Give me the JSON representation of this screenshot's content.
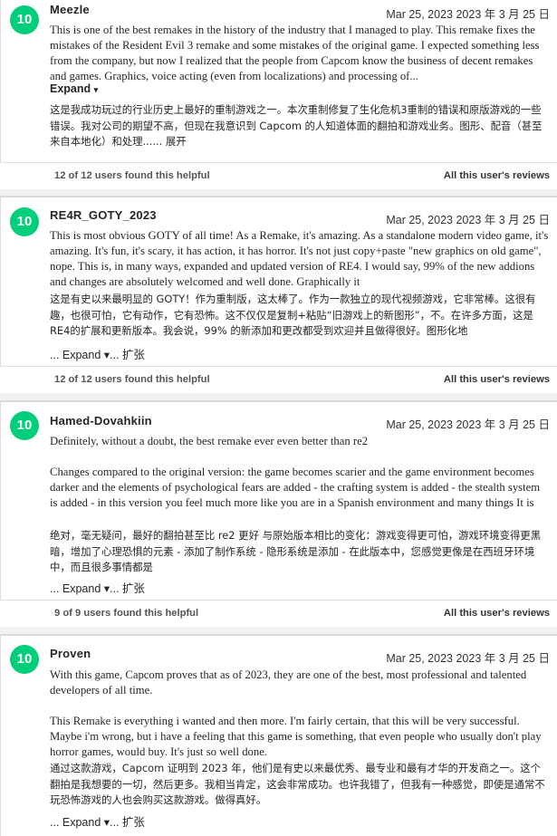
{
  "reviews": [
    {
      "score": "10",
      "user": "Meezle",
      "date": "Mar 25, 2023 2023 年 3 月 25 日",
      "text": "This is one of the best remakes in the history of the industry that I managed to play. This remake fixes the mistakes of the Resident Evil 3 remake and some mistakes of the original game. I expected something less from the company, but now I realized that the people from Capcom know the business of decent remakes and games. Graphics, voice acting (even from localizations) and processing of...",
      "expand": "Expand",
      "translation": "这是我成功玩过的行业历史上最好的重制游戏之一。本次重制修复了生化危机3重制的错误和原版游戏的一些错误。我对公司的期望不高，但现在我意识到 Capcom 的人知道体面的翻拍和游戏业务。图形、配音（甚至来自本地化）和处理...... 展开",
      "helpful": "12 of 12 users found this helpful",
      "all_reviews": "All this user's reviews"
    },
    {
      "score": "10",
      "user": "RE4R_GOTY_2023",
      "date": "Mar 25, 2023 2023 年 3 月 25 日",
      "text": "This is most obvious GOTY of all time! As a Remake, it's amazing. As a standalone modern video game, it's amazing. It's fun, it's scary, it has action, it has horror. It's not just copy+paste \"new graphics on old game\", nope. This is, in many ways, expanded and updated version of RE4. I would say, 99% of the new addions and changes are absolutely welcomed and well done. Graphically it",
      "translation": "这是有史以来最明显的 GOTY！作为重制版，这太棒了。作为一款独立的现代视频游戏，它非常棒。这很有趣，也很可怕，它有动作，它有恐怖。这不仅仅是复制+粘贴“旧游戏上的新图形”，不。在许多方面，这是 RE4的扩展和更新版本。我会说，99% 的新添加和更改都受到欢迎并且做得很好。图形化地",
      "expand": "... Expand ▾... 扩张",
      "helpful": "12 of 12 users found this helpful",
      "all_reviews": "All this user's reviews"
    },
    {
      "score": "10",
      "user": "Hamed-Dovahkiin",
      "date": "Mar 25, 2023 2023 年 3 月 25 日",
      "text": "Definitely, without a doubt, the best remake ever even better than re2\n\nChanges compared to the original version: the game becomes scarier and the game environment becomes darker and the elements of psychological fears are added - the crafting system is added - the stealth system is added - in this version you feel much more like you are in a Spanish environment and many things It is",
      "translation": "绝对，毫无疑问，最好的翻拍甚至比 re2 更好 与原始版本相比的变化：游戏变得更可怕，游戏环境变得更黑暗，增加了心理恐惧的元素 - 添加了制作系统 - 隐形系统是添加 - 在此版本中，您感觉更像是在西班牙环境中，而且很多事情都是",
      "expand": "... Expand ▾... 扩张",
      "helpful": "9 of 9 users found this helpful",
      "all_reviews": "All this user's reviews"
    },
    {
      "score": "10",
      "user": "Proven",
      "date": "Mar 25, 2023 2023 年 3 月 25 日",
      "text": "With this game, Capcom proves that as of 2023, they are one of the best, most professional and talented developers of all time.\n\nThis Remake is everything i wanted and then more. I'm fairly certain, that this will be very successful. Maybe i'm wrong, but i have a feeling that this game is something, that even people who usually don't play horror games, would buy. It's just so well done.",
      "translation": "通过这款游戏，Capcom 证明到 2023 年，他们是有史以来最优秀、最专业和最有才华的开发商之一。这个翻拍是我想要的一切，然后更多。我相当肯定，这会非常成功。也许我错了，但我有一种感觉，即使是通常不玩恐怖游戏的人也会购买这款游戏。做得真好。",
      "expand": "... Expand ▾... 扩张"
    }
  ],
  "colors": {
    "score_badge": "#00ce7a",
    "text": "#262626",
    "divider": "#d9d9d9"
  },
  "icons": {
    "expand_arrow": "caret-down-icon"
  }
}
